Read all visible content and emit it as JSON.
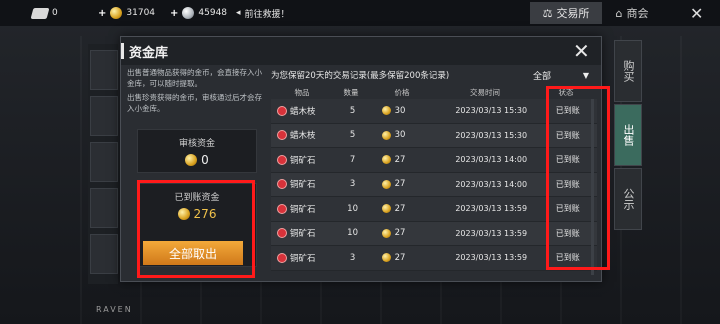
{
  "topbar": {
    "tickets": "0",
    "gold": "31704",
    "silver": "45948",
    "notice": "前往救援！",
    "trade_tab": "交易所",
    "shop_tab": "商会"
  },
  "side_tabs": [
    "购买",
    "出售",
    "公示"
  ],
  "brand": "RAVEN",
  "modal": {
    "title": "资金库",
    "notes": [
      "出售普通物品获得的金币，会直接存入小金库，可以随时提取。",
      "出售珍贵获得的金币，审核通过后才会存入小金库。"
    ],
    "review_label": "审核资金",
    "review_value": "0",
    "arrived_label": "已到账资金",
    "arrived_value": "276",
    "take_all": "全部取出",
    "records_header": "为您保留20天的交易记录(最多保留200条记录)",
    "filter": "全部",
    "columns": [
      "物品",
      "数量",
      "价格",
      "交易时间",
      "状态"
    ],
    "rows": [
      {
        "item": "蜡木枝",
        "qty": "5",
        "price": "30",
        "time": "2023/03/13  15:30",
        "status": "已到账"
      },
      {
        "item": "蜡木枝",
        "qty": "5",
        "price": "30",
        "time": "2023/03/13  15:30",
        "status": "已到账"
      },
      {
        "item": "铜矿石",
        "qty": "7",
        "price": "27",
        "time": "2023/03/13  14:00",
        "status": "已到账"
      },
      {
        "item": "铜矿石",
        "qty": "3",
        "price": "27",
        "time": "2023/03/13  14:00",
        "status": "已到账"
      },
      {
        "item": "铜矿石",
        "qty": "10",
        "price": "27",
        "time": "2023/03/13  13:59",
        "status": "已到账"
      },
      {
        "item": "铜矿石",
        "qty": "10",
        "price": "27",
        "time": "2023/03/13  13:59",
        "status": "已到账"
      },
      {
        "item": "铜矿石",
        "qty": "3",
        "price": "27",
        "time": "2023/03/13  13:59",
        "status": "已到账"
      }
    ]
  },
  "colors": {
    "highlight": "#ff1a1a",
    "gold": "#f0c24b",
    "button": "#e8901f"
  }
}
